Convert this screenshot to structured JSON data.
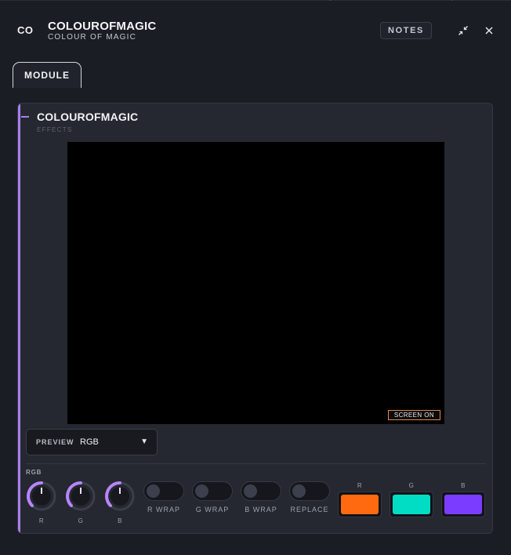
{
  "header": {
    "badge": "CO",
    "title": "COLOUROFMAGIC",
    "subtitle": "COLOUR OF MAGIC",
    "notes_label": "NOTES",
    "minimize_icon": "collapse-arrows-icon",
    "close_icon": "close-icon"
  },
  "tabs": [
    {
      "label": "MODULE",
      "active": true
    }
  ],
  "panel": {
    "title": "COLOUROFMAGIC",
    "subtitle": "EFFECTS",
    "accent_color": "#a97ff0",
    "screen_badge": "SCREEN ON"
  },
  "preview": {
    "label": "PREVIEW",
    "value": "RGB"
  },
  "rgb": {
    "section_label": "RGB",
    "knobs": [
      {
        "label": "R"
      },
      {
        "label": "G"
      },
      {
        "label": "B"
      }
    ],
    "toggles": [
      {
        "label": "R WRAP",
        "on": false
      },
      {
        "label": "G WRAP",
        "on": false
      },
      {
        "label": "B WRAP",
        "on": false
      },
      {
        "label": "REPLACE",
        "on": false
      }
    ],
    "swatches": [
      {
        "label": "R",
        "color": "#ff6a10"
      },
      {
        "label": "G",
        "color": "#00ddc4"
      },
      {
        "label": "B",
        "color": "#7c3cff"
      }
    ]
  }
}
